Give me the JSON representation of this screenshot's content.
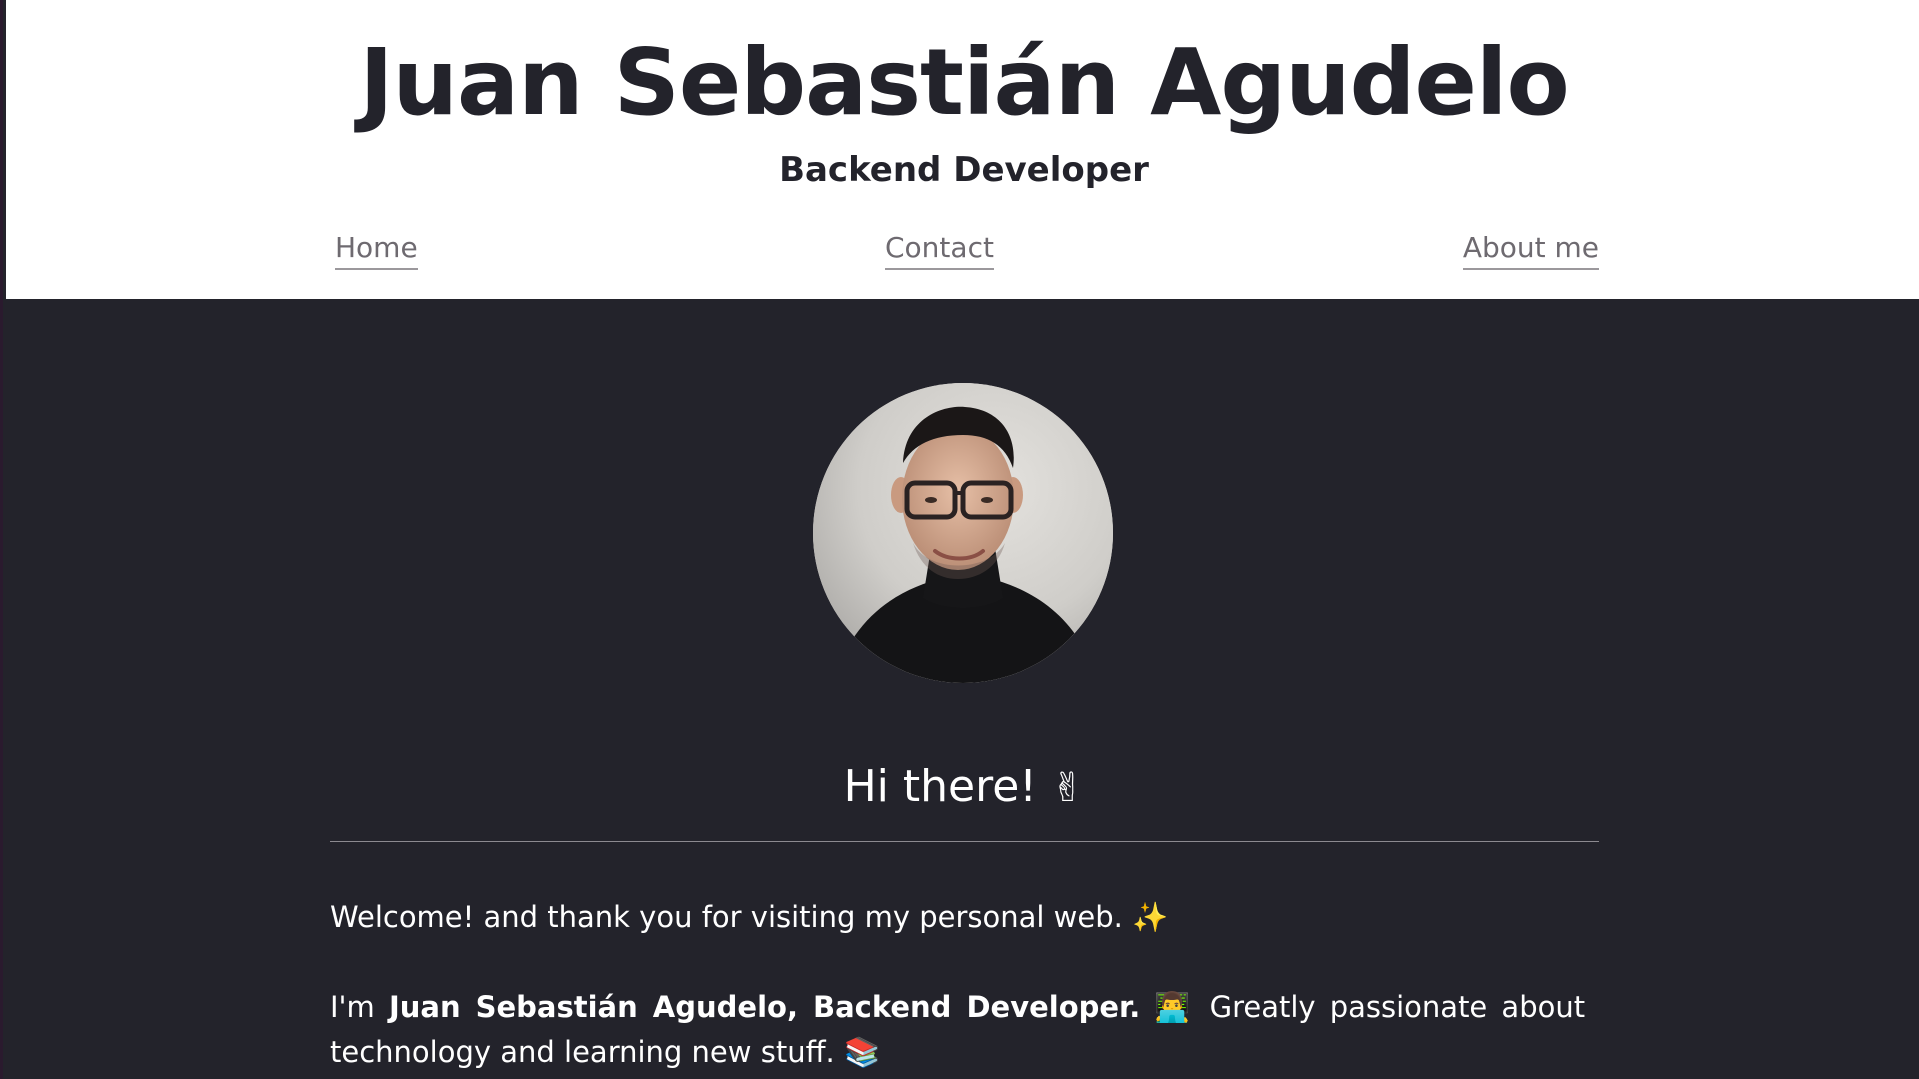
{
  "header": {
    "title": "Juan Sebastián Agudelo",
    "subtitle": "Backend Developer",
    "nav": {
      "home": "Home",
      "contact": "Contact",
      "about": "About me"
    }
  },
  "main": {
    "greeting": "Hi there!",
    "greeting_emoji": "✌",
    "welcome_text": "Welcome! and thank you for visiting my personal web.",
    "welcome_emoji": "✨",
    "intro_prefix": "I'm",
    "intro_bold": "Juan Sebastián Agudelo, Backend Developer.",
    "intro_emoji": "👨‍💻",
    "intro_text": "Greatly passionate about technology and learning new stuff.",
    "intro_end_emoji": "📚"
  },
  "colors": {
    "header_bg": "#ffffff",
    "main_bg": "#23232b",
    "text_dark": "#23232b",
    "nav_link": "#6e6a70",
    "text_light": "#ffffff"
  }
}
